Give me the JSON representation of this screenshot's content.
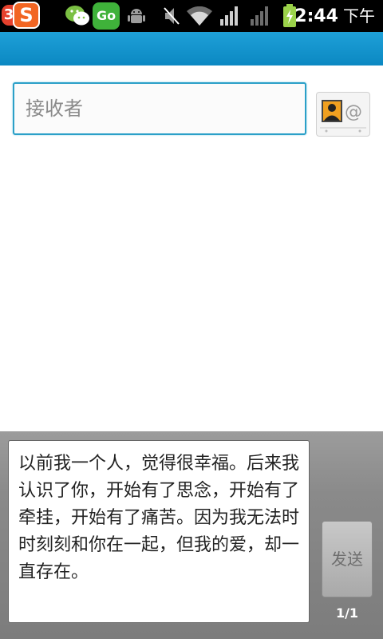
{
  "status_bar": {
    "notif_count": "3",
    "sogou_label": "S",
    "go_label": "Go",
    "time": "2:44",
    "ampm": "下午"
  },
  "compose": {
    "recipient_placeholder": "接收者",
    "message_text": "以前我一个人，觉得很幸福。后来我认识了你，开始有了思念，开始有了牵挂，开始有了痛苦。因为我无法时时刻刻和你在一起，但我的爱，却一直存在。",
    "send_label": "发送",
    "page_counter": "1/1"
  },
  "colors": {
    "title_bar": "#0b88c2",
    "focus_border": "#2ba0c8"
  },
  "icons": [
    "notification-count-icon",
    "sogou-icon",
    "wechat-icon",
    "go-launcher-icon",
    "android-debug-icon",
    "mute-icon",
    "wifi-icon",
    "signal-icon",
    "battery-icon",
    "contact-picker-icon"
  ]
}
